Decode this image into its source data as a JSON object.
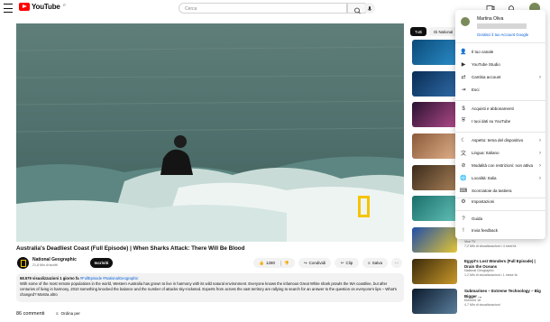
{
  "header": {
    "logo_text": "YouTube",
    "logo_country": "IT",
    "search_placeholder": "Cerca"
  },
  "video": {
    "title": "Australia's Deadliest Coast (Full Episode) | When Sharks Attack: There Will Be Blood",
    "channel": "National Geographic",
    "subscribers": "21,8 Mln di iscritti",
    "subscribe_label": "Iscriviti",
    "likes": "1280",
    "share_label": "Condividi",
    "clip_label": "Clip",
    "save_label": "Salva",
    "more_label": "···",
    "description": {
      "stats": "68.579 visualizzazioni  1 giorno fa",
      "tags": "#FullEpisode #NationalGeographic",
      "text": "With some of the most remote populations in the world, Western Australia has grown to live in harmony with its wild natural environment. Everyone knows the infamous Great White shark prowls the WA coastline, but after centuries of living in harmony, 2010 something knocked the balance and the number of attacks sky-rocketed. Experts from across the vast territory are rallying to search for an answer to the question on everyone's lips – What's changed? Mostra altro"
    },
    "comments_count": "86 commenti",
    "sort_label": "Ordina per"
  },
  "sidebar": {
    "chips": [
      "Tutti",
      "Di National"
    ],
    "items": [
      {
        "title": "",
        "meta": "",
        "duration": ""
      },
      {
        "title": "",
        "meta": "",
        "duration": ""
      },
      {
        "title": "",
        "meta": "",
        "duration": ""
      },
      {
        "title": "",
        "meta": "",
        "duration": ""
      },
      {
        "title": "",
        "meta": "",
        "duration": ""
      },
      {
        "title": "",
        "meta": "",
        "duration": ""
      },
      {
        "title": "",
        "meta": "Vice TV",
        "meta2": "7,2 Mln di visualizzazioni • 4 mesi fa",
        "duration": ""
      },
      {
        "title": "Egypt's Lost Wonders (Full Episode) | Drain the Oceans",
        "meta": "National Geographic",
        "meta2": "1,2 Mln di visualizzazioni • 1 mese fa",
        "duration": ""
      },
      {
        "title": "Submarines – Extreme Technology – Big Bigger …",
        "meta": "Element 18",
        "meta2": "4,7 Mln di visualizzazioni",
        "duration": ""
      }
    ]
  },
  "account_menu": {
    "name": "Martina Oliva",
    "manage_label": "Gestisci il tuo Account Google",
    "items": [
      {
        "label": "Il tuo canale",
        "icon": "person-icon"
      },
      {
        "label": "YouTube Studio",
        "icon": "studio-icon"
      },
      {
        "label": "Cambia account",
        "icon": "switch-account-icon",
        "chevron": true
      },
      {
        "label": "Esci",
        "icon": "sign-out-icon"
      },
      {
        "label": "Acquisti e abbonamenti",
        "icon": "dollar-icon"
      },
      {
        "label": "I tuoi dati su YouTube",
        "icon": "shield-icon"
      },
      {
        "label": "Aspetto: tema del dispositivo",
        "icon": "moon-icon",
        "chevron": true
      },
      {
        "label": "Lingua: Italiano",
        "icon": "translate-icon",
        "chevron": true
      },
      {
        "label": "Modalità con restrizioni: non attiva",
        "icon": "restricted-icon",
        "chevron": true
      },
      {
        "label": "Località: Italia",
        "icon": "globe-icon",
        "chevron": true
      },
      {
        "label": "Scorciatoie da tastiera",
        "icon": "keyboard-icon"
      },
      {
        "label": "Impostazioni",
        "icon": "gear-icon"
      },
      {
        "label": "Guida",
        "icon": "help-icon"
      },
      {
        "label": "Invia feedback",
        "icon": "feedback-icon"
      }
    ]
  },
  "colors": {
    "brand": "#ff0000",
    "link": "#065fd4",
    "ng_yellow": "#f5c400"
  }
}
